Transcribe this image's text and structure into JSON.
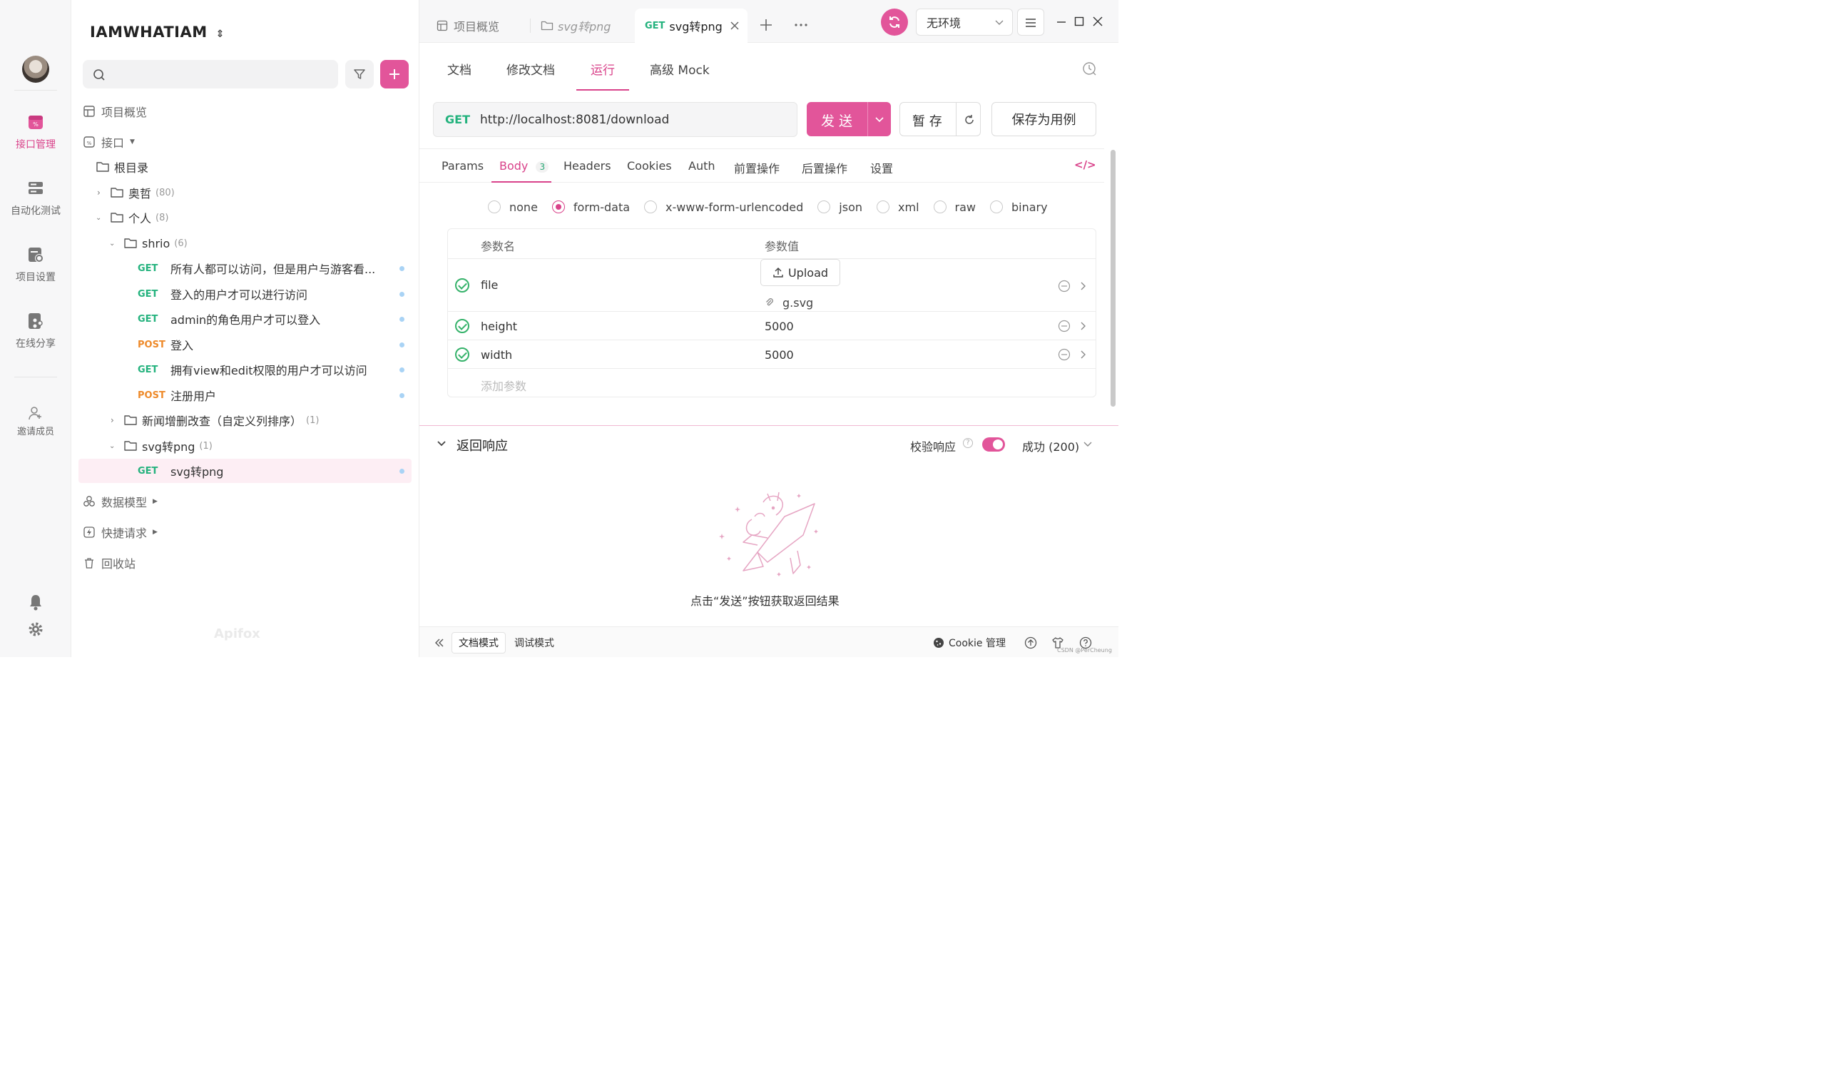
{
  "colors": {
    "accent": "#e2559a",
    "get": "#23b27d",
    "post": "#ee8a2a",
    "success": "#35b26a"
  },
  "rail": {
    "items": [
      {
        "label": "接口管理",
        "icon": "api-icon",
        "active": true
      },
      {
        "label": "自动化测试",
        "icon": "automation-icon"
      },
      {
        "label": "项目设置",
        "icon": "project-settings-icon"
      },
      {
        "label": "在线分享",
        "icon": "share-icon"
      }
    ],
    "invite_label": "邀请成员"
  },
  "tree": {
    "project_name": "IAMWHATIAM",
    "overview": "项目概览",
    "interfaces": "接口",
    "root": "根目录",
    "folder_aozhe": {
      "name": "奥哲",
      "count": "(80)"
    },
    "folder_personal": {
      "name": "个人",
      "count": "(8)"
    },
    "folder_shrio": {
      "name": "shrio",
      "count": "(6)"
    },
    "apis": [
      {
        "method": "GET",
        "name": "所有人都可以访问，但是用户与游客看..."
      },
      {
        "method": "GET",
        "name": "登入的用户才可以进行访问"
      },
      {
        "method": "GET",
        "name": "admin的角色用户才可以登入"
      },
      {
        "method": "POST",
        "name": "登入"
      },
      {
        "method": "GET",
        "name": "拥有view和edit权限的用户才可以访问"
      },
      {
        "method": "POST",
        "name": "注册用户"
      }
    ],
    "folder_news": {
      "name": "新闻增删改查（自定义列排序）",
      "count": "(1)"
    },
    "folder_svg": {
      "name": "svg转png",
      "count": "(1)"
    },
    "selected_api": {
      "method": "GET",
      "name": "svg转png"
    },
    "data_models": "数据模型",
    "quick_requests": "快捷请求",
    "recycle_bin": "回收站",
    "watermark": "Apifox"
  },
  "tabs": {
    "overview": "项目概览",
    "svg_folder": "svg转png",
    "active_method": "GET",
    "active_name": "svg转png",
    "environment": "无环境"
  },
  "doc_tabs": [
    "文档",
    "修改文档",
    "运行",
    "高级 Mock"
  ],
  "request": {
    "method": "GET",
    "url": "http://localhost:8081/download",
    "send": "发 送",
    "save_temp": "暂 存",
    "save_case": "保存为用例"
  },
  "req_tabs": {
    "params": "Params",
    "body": "Body",
    "body_count": "3",
    "headers": "Headers",
    "cookies": "Cookies",
    "auth": "Auth",
    "pre": "前置操作",
    "post": "后置操作",
    "settings": "设置"
  },
  "body_types": [
    "none",
    "form-data",
    "x-www-form-urlencoded",
    "json",
    "xml",
    "raw",
    "binary"
  ],
  "body_type_selected": "form-data",
  "params": {
    "col_name": "参数名",
    "col_value": "参数值",
    "upload_label": "Upload",
    "file_name": "g.svg",
    "rows": [
      {
        "name": "file",
        "value": ""
      },
      {
        "name": "height",
        "value": "5000"
      },
      {
        "name": "width",
        "value": "5000"
      }
    ],
    "add_placeholder": "添加参数"
  },
  "response": {
    "title": "返回响应",
    "validate_label": "校验响应",
    "status": "成功 (200)",
    "empty_hint": "点击“发送”按钮获取返回结果"
  },
  "bottom": {
    "doc_mode": "文档模式",
    "debug_mode": "调试模式",
    "cookie_mgmt": "Cookie 管理",
    "credit": "CSDN @PerCheung"
  }
}
